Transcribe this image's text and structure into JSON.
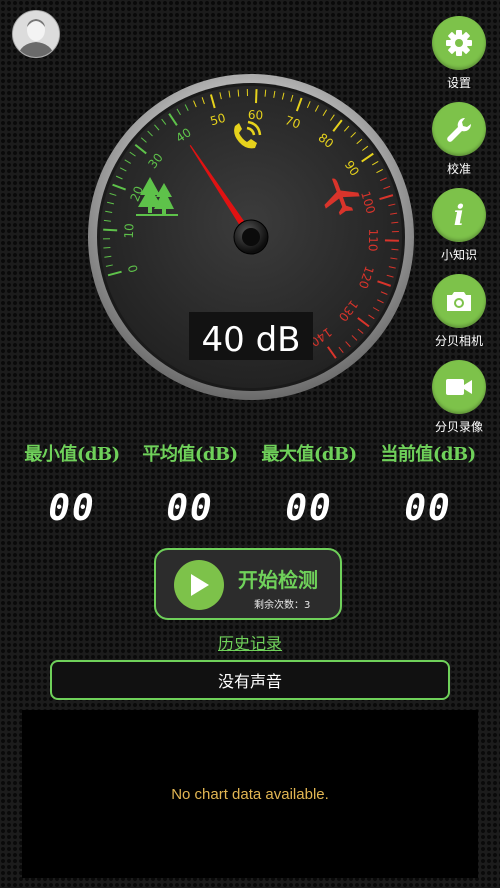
{
  "gauge": {
    "reading": "40 dB",
    "needle_value": 40,
    "scale_min": 0,
    "scale_max": 140,
    "ticks": [
      "0",
      "10",
      "20",
      "30",
      "40",
      "50",
      "60",
      "70",
      "80",
      "90",
      "100",
      "110",
      "120",
      "130",
      "140"
    ],
    "colors": {
      "low": "#5ec24a",
      "mid": "#e6d21c",
      "high": "#d9342b",
      "needle": "#e01212"
    }
  },
  "side_menu": [
    {
      "icon": "gear-icon",
      "label": "设置"
    },
    {
      "icon": "wrench-icon",
      "label": "校准"
    },
    {
      "icon": "info-icon",
      "label": "小知识"
    },
    {
      "icon": "camera-icon",
      "label": "分贝相机"
    },
    {
      "icon": "video-camera-icon",
      "label": "分贝录像"
    }
  ],
  "stats": [
    {
      "title": "最小值(dB)",
      "value": "00"
    },
    {
      "title": "平均值(dB)",
      "value": "00"
    },
    {
      "title": "最大值(dB)",
      "value": "00"
    },
    {
      "title": "当前值(dB)",
      "value": "00"
    }
  ],
  "start_button": {
    "label": "开始检测",
    "remaining": "剩余次数：3"
  },
  "history_link": "历史记录",
  "status": "没有声音",
  "chart": {
    "empty_message": "No chart data available."
  },
  "theme": {
    "accent": "#6fd15a",
    "button": "#7dc24a",
    "background": "#1c1c1c"
  }
}
